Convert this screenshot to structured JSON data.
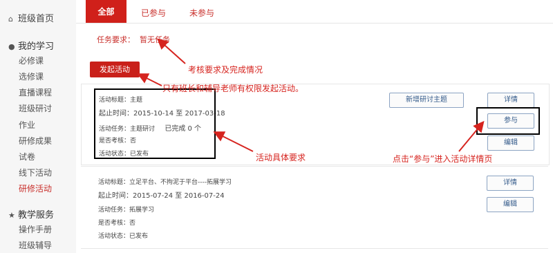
{
  "sidebar": {
    "home": "班级首页",
    "my_study": {
      "title": "我的学习",
      "items": [
        "必修课",
        "选修课",
        "直播课程",
        "班级研讨",
        "作业",
        "研修成果",
        "试卷",
        "线下活动",
        "研修活动"
      ]
    },
    "teaching": {
      "title": "教学服务",
      "items": [
        "操作手册",
        "班级辅导"
      ]
    }
  },
  "tabs": [
    "全部",
    "已参与",
    "未参与"
  ],
  "requirement": {
    "label": "任务要求：",
    "value": "暂无任务"
  },
  "launch_button": "发起活动",
  "activities": [
    {
      "title": "活动标题：主题",
      "time": "起止时间：2015-10-14 至 2017-03-18",
      "task": "活动任务：主题研讨",
      "progress": "已完成 0 个",
      "assess": "是否考核：否",
      "status": "活动状态：已发布",
      "buttons": {
        "new_topic": "新增研讨主题",
        "detail": "详情",
        "join": "参与",
        "edit": "编辑"
      }
    },
    {
      "title": "活动标题：立足平台、不拘泥于平台----拓展学习",
      "time": "起止时间：2015-07-24 至 2016-07-24",
      "task": "活动任务：拓展学习",
      "assess": "是否考核：否",
      "status": "活动状态：已发布",
      "buttons": {
        "detail": "详情",
        "edit": "编辑"
      }
    }
  ],
  "annotations": {
    "requirement": "考核要求及完成情况",
    "launch": "只有班长和辅导老师有权限发起活动。",
    "specifics": "活动具体要求",
    "join": "点击“参与”进入活动详情页"
  },
  "colors": {
    "accent": "#d0201a",
    "annotation": "#d6241f",
    "button_border": "#8ba3c2"
  },
  "icons": [
    "home-icon",
    "user-icon",
    "star-icon"
  ]
}
